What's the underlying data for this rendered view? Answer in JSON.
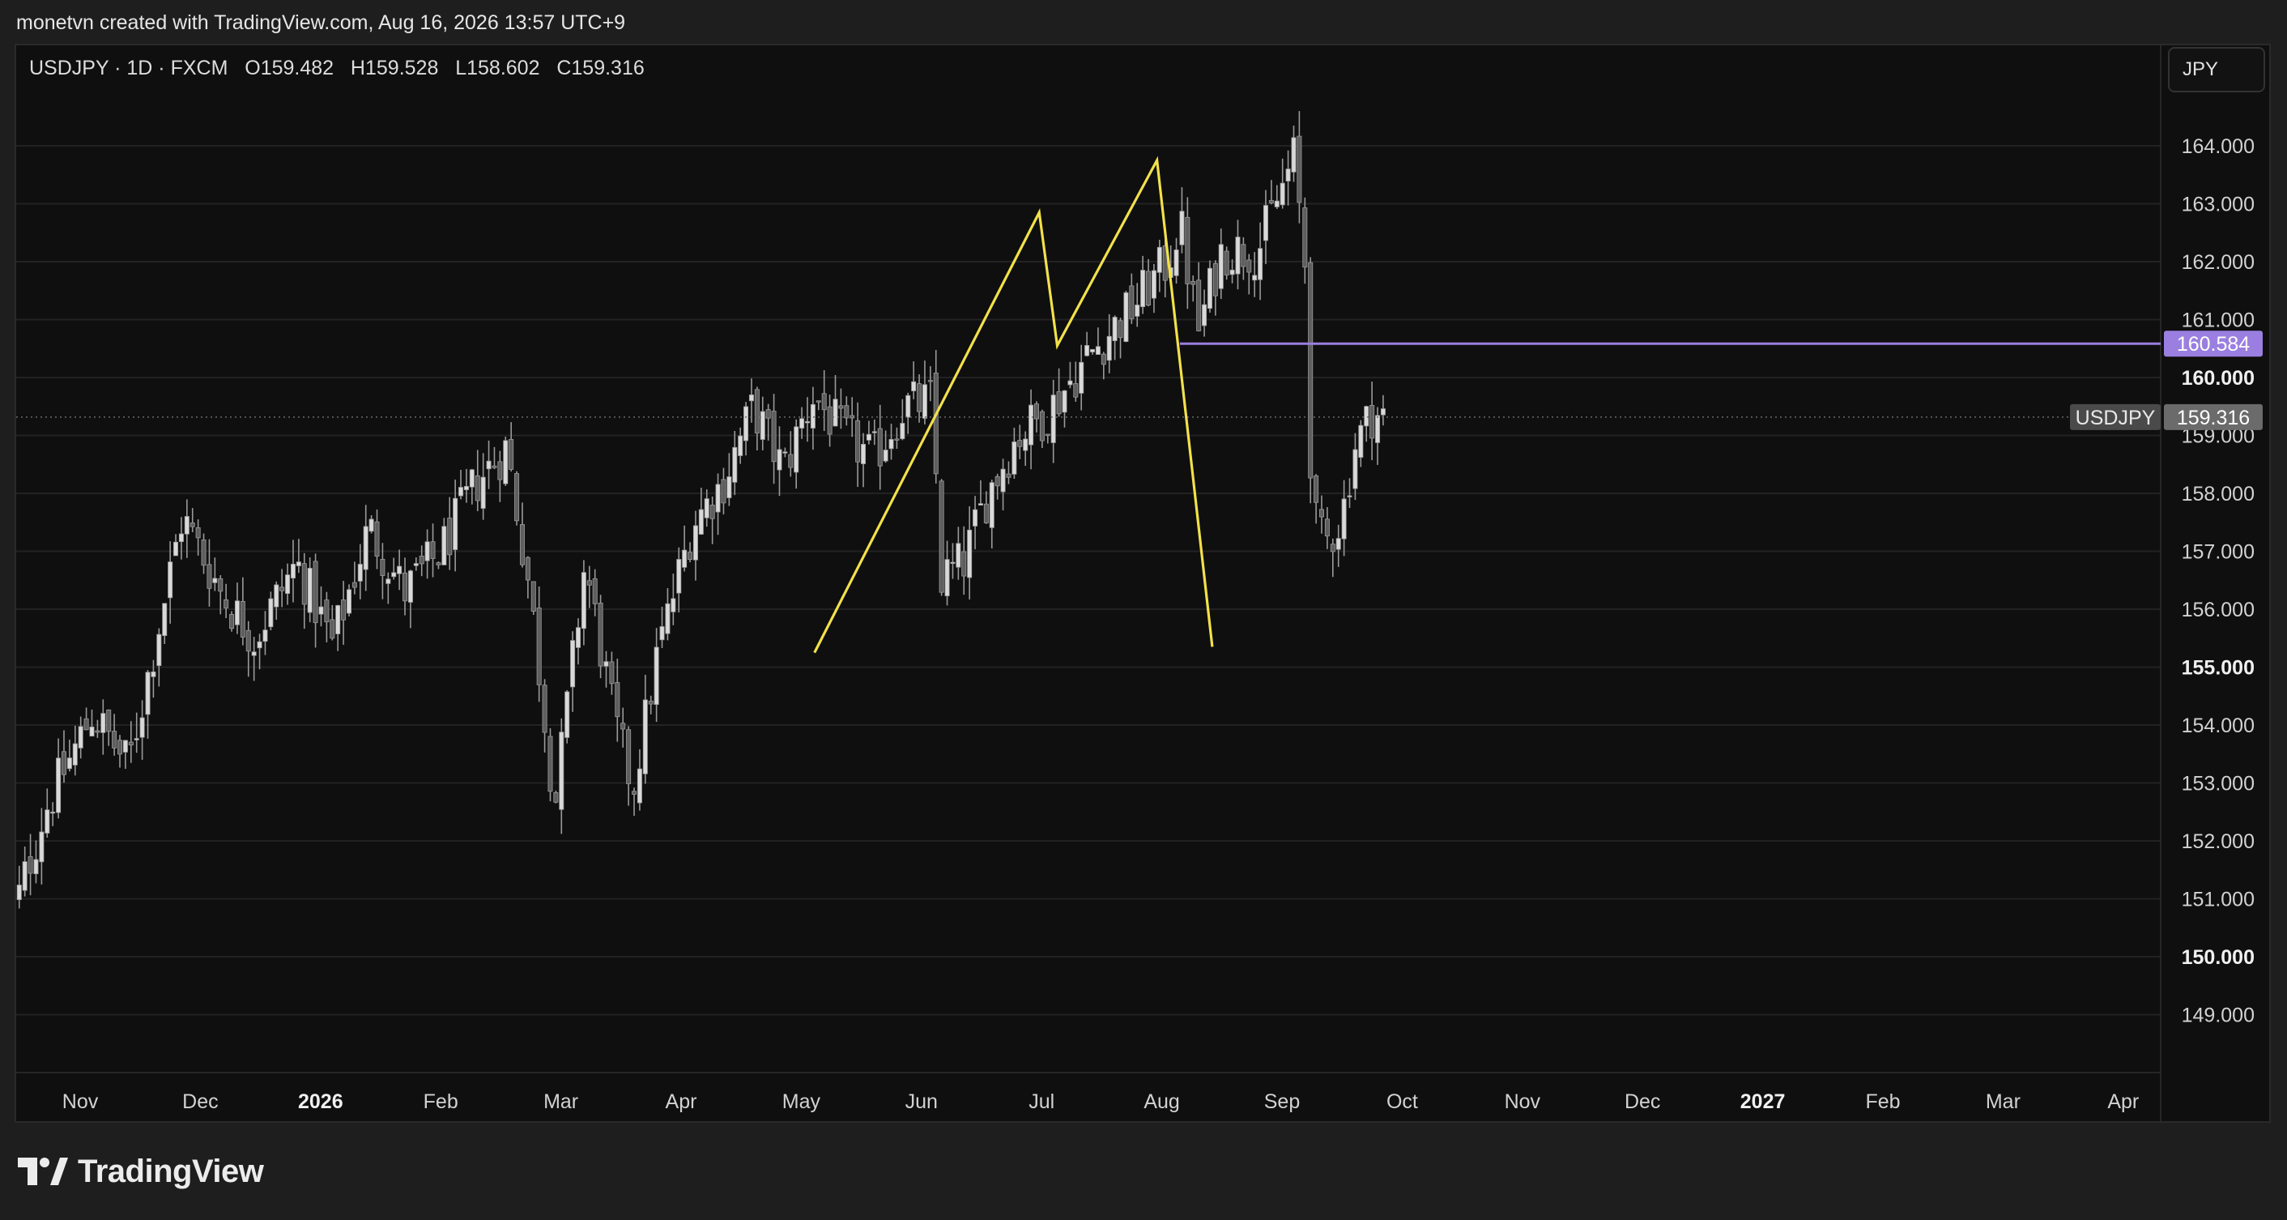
{
  "caption": "monetvn created with TradingView.com, Aug 16, 2026 13:57 UTC+9",
  "legend": {
    "symbol": "USDJPY · 1D · FXCM",
    "open": "O159.482",
    "high": "H159.528",
    "low": "L158.602",
    "close": "C159.316"
  },
  "currency_label": "JPY",
  "brand": "TradingView",
  "colors": {
    "background": "#0f0f0f",
    "candle": "#9a9a9a",
    "pattern": "#f2e14a",
    "level": "#9a7fe0",
    "price_tag": "#6b6b6b"
  },
  "chart_data": {
    "type": "candlestick",
    "symbol": "USDJPY",
    "interval": "1D",
    "ylim": [
      148.0,
      165.5
    ],
    "y_ticks": [
      {
        "label": "164.000",
        "value": 164,
        "bold": false
      },
      {
        "label": "163.000",
        "value": 163,
        "bold": false
      },
      {
        "label": "162.000",
        "value": 162,
        "bold": false
      },
      {
        "label": "161.000",
        "value": 161,
        "bold": false
      },
      {
        "label": "160.000",
        "value": 160,
        "bold": true
      },
      {
        "label": "159.000",
        "value": 159,
        "bold": false
      },
      {
        "label": "158.000",
        "value": 158,
        "bold": false
      },
      {
        "label": "157.000",
        "value": 157,
        "bold": false
      },
      {
        "label": "156.000",
        "value": 156,
        "bold": false
      },
      {
        "label": "155.000",
        "value": 155,
        "bold": true
      },
      {
        "label": "154.000",
        "value": 154,
        "bold": false
      },
      {
        "label": "153.000",
        "value": 153,
        "bold": false
      },
      {
        "label": "152.000",
        "value": 152,
        "bold": false
      },
      {
        "label": "151.000",
        "value": 151,
        "bold": false
      },
      {
        "label": "150.000",
        "value": 150,
        "bold": true
      },
      {
        "label": "149.000",
        "value": 149,
        "bold": false
      }
    ],
    "x_ticks": [
      {
        "label": "Nov",
        "month": 0,
        "bold": false
      },
      {
        "label": "Dec",
        "month": 1,
        "bold": false
      },
      {
        "label": "2026",
        "month": 2,
        "bold": true
      },
      {
        "label": "Feb",
        "month": 3,
        "bold": false
      },
      {
        "label": "Mar",
        "month": 4,
        "bold": false
      },
      {
        "label": "Apr",
        "month": 5,
        "bold": false
      },
      {
        "label": "May",
        "month": 6,
        "bold": false
      },
      {
        "label": "Jun",
        "month": 7,
        "bold": false
      },
      {
        "label": "Jul",
        "month": 8,
        "bold": false
      },
      {
        "label": "Aug",
        "month": 9,
        "bold": false
      },
      {
        "label": "Sep",
        "month": 10,
        "bold": false
      },
      {
        "label": "Oct",
        "month": 11,
        "bold": false
      },
      {
        "label": "Nov",
        "month": 12,
        "bold": false
      },
      {
        "label": "Dec",
        "month": 13,
        "bold": false
      },
      {
        "label": "2027",
        "month": 14,
        "bold": true
      },
      {
        "label": "Feb",
        "month": 15,
        "bold": false
      },
      {
        "label": "Mar",
        "month": 16,
        "bold": false
      },
      {
        "label": "Apr",
        "month": 17,
        "bold": false
      }
    ],
    "close_path": [
      [
        -0.6,
        150.4
      ],
      [
        -0.3,
        152.5
      ],
      [
        0.1,
        154.2
      ],
      [
        0.4,
        153.3
      ],
      [
        0.6,
        155.2
      ],
      [
        0.85,
        157.6
      ],
      [
        1.2,
        156.2
      ],
      [
        1.45,
        155.5
      ],
      [
        1.8,
        156.8
      ],
      [
        2.1,
        155.4
      ],
      [
        2.4,
        157.4
      ],
      [
        2.7,
        156.3
      ],
      [
        3.0,
        157.0
      ],
      [
        3.3,
        158.2
      ],
      [
        3.55,
        158.8
      ],
      [
        3.75,
        156.2
      ],
      [
        3.95,
        152.6
      ],
      [
        4.2,
        156.8
      ],
      [
        4.45,
        154.0
      ],
      [
        4.6,
        152.9
      ],
      [
        4.8,
        155.2
      ],
      [
        5.1,
        157.5
      ],
      [
        5.35,
        158.2
      ],
      [
        5.6,
        159.5
      ],
      [
        5.85,
        158.4
      ],
      [
        6.1,
        159.7
      ],
      [
        6.35,
        159.0
      ],
      [
        6.6,
        158.6
      ],
      [
        6.85,
        159.5
      ],
      [
        7.1,
        159.6
      ],
      [
        7.15,
        156.5
      ],
      [
        7.35,
        156.8
      ],
      [
        7.55,
        158.0
      ],
      [
        7.8,
        159.0
      ],
      [
        8.05,
        159.4
      ],
      [
        8.4,
        160.4
      ],
      [
        8.75,
        161.2
      ],
      [
        9.05,
        162.0
      ],
      [
        9.15,
        162.7
      ],
      [
        9.3,
        160.8
      ],
      [
        9.5,
        162.2
      ],
      [
        9.8,
        162.2
      ],
      [
        9.95,
        163.0
      ],
      [
        10.1,
        163.8
      ],
      [
        10.2,
        161.8
      ],
      [
        10.25,
        157.6
      ],
      [
        10.35,
        157.1
      ],
      [
        10.5,
        157.6
      ],
      [
        10.6,
        158.8
      ],
      [
        10.75,
        159.4
      ],
      [
        10.85,
        159.3
      ]
    ],
    "last_price": {
      "value": 159.316,
      "symbol_label": "USDJPY",
      "price_label": "159.316"
    },
    "level": {
      "value": 160.584,
      "label": "160.584",
      "start_month": 9.15
    },
    "pattern_line": [
      [
        6.11,
        155.25
      ],
      [
        7.98,
        162.85
      ],
      [
        8.13,
        160.55
      ],
      [
        8.96,
        163.75
      ],
      [
        9.42,
        155.35
      ]
    ]
  }
}
